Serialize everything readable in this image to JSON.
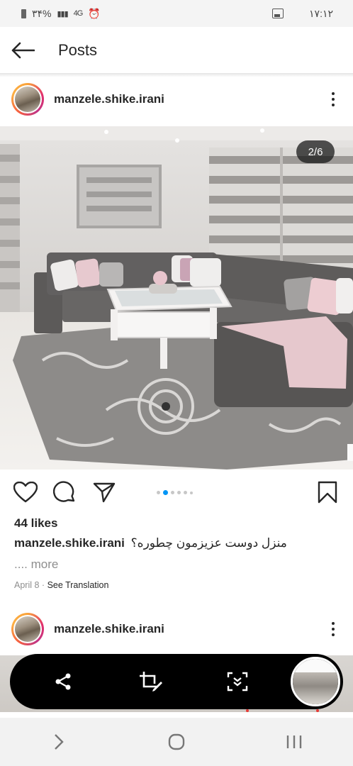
{
  "status_bar": {
    "battery": "۳۴%",
    "network": "4G",
    "time": "۱۷:۱۲",
    "icons": [
      "battery-icon",
      "signal-icon",
      "alarm-icon",
      "gallery-icon"
    ]
  },
  "header": {
    "title": "Posts",
    "back_icon": "arrow-left-icon"
  },
  "post": {
    "username": "manzele.shike.irani",
    "image_counter": "2/6",
    "carousel": {
      "total": 6,
      "active_index": 1
    },
    "likes": "44 likes",
    "caption_user": "manzele.shike.irani",
    "caption_text": "منزل دوست عزیزمون چطوره؟",
    "more": ".... more",
    "date": "April 8",
    "separator": "·",
    "see_translation": "See Translation",
    "actions": [
      "heart-icon",
      "comment-icon",
      "share-icon",
      "bookmark-icon"
    ]
  },
  "next_post": {
    "username": "manzele.shike.irani"
  },
  "share_overlay": {
    "icons": [
      "share-icon",
      "crop-edit-icon",
      "scroll-capture-icon",
      "screenshot-thumbnail"
    ]
  },
  "nav_bar": {
    "icons": [
      "back-chevron-icon",
      "home-circle-icon",
      "recents-icon"
    ]
  },
  "colors": {
    "accent_blue": "#0095f6",
    "text_primary": "#262626",
    "text_secondary": "#8e8e8e",
    "ring_start": "#f9a33a",
    "ring_end": "#c13584"
  }
}
